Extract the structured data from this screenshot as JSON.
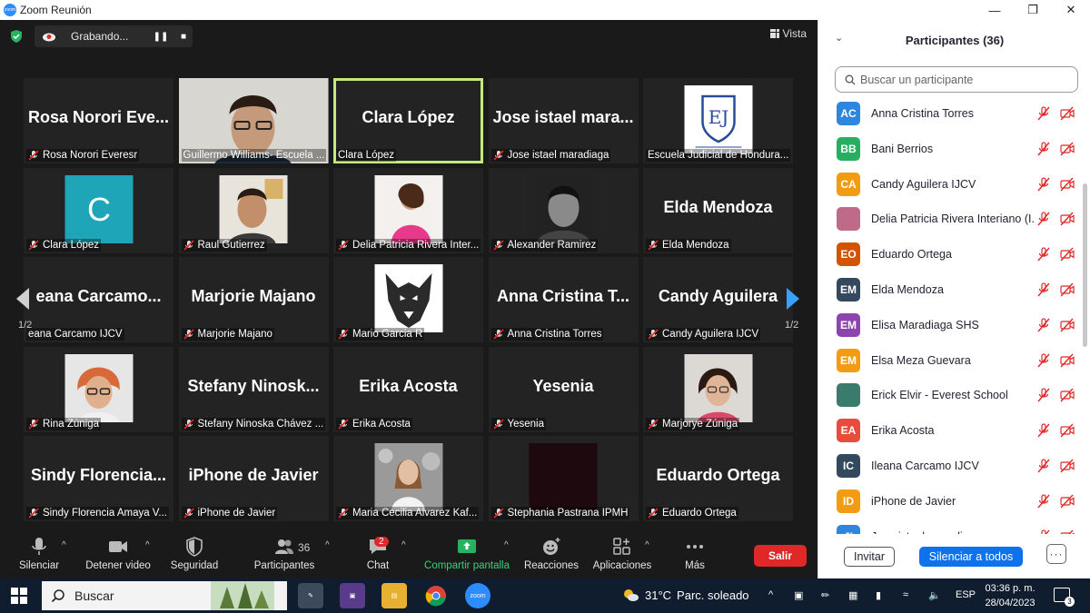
{
  "window": {
    "title": "Zoom Reunión",
    "controls": [
      "minimize",
      "maximize",
      "close"
    ]
  },
  "topbar": {
    "recording_label": "Grabando...",
    "view_label": "Vista"
  },
  "pagination": {
    "left": "1/2",
    "right": "1/2"
  },
  "tiles": [
    {
      "name": "Rosa Norori Eve...",
      "label": "Rosa Norori Everesr",
      "muted": true,
      "photo": "none"
    },
    {
      "name": "",
      "label": "Guillermo Williams- Escuela ...",
      "muted": false,
      "photo": "man-glasses"
    },
    {
      "name": "Clara López",
      "label": "Clara López",
      "muted": false,
      "photo": "none",
      "active": true
    },
    {
      "name": "Jose istael mara...",
      "label": "Jose istael maradiaga",
      "muted": true,
      "photo": "none"
    },
    {
      "name": "",
      "label": "Escuela Judicial de Hondura...",
      "muted": false,
      "photo": "logo"
    },
    {
      "name": "",
      "label": "Clara López",
      "muted": true,
      "photo": "letter-c"
    },
    {
      "name": "",
      "label": "Raul Gutierrez",
      "muted": true,
      "photo": "man-selfie"
    },
    {
      "name": "",
      "label": "Delia Patricia Rivera Inter...",
      "muted": true,
      "photo": "woman-pink"
    },
    {
      "name": "",
      "label": "Alexander Ramirez",
      "muted": true,
      "photo": "man-bw"
    },
    {
      "name": "Elda Mendoza",
      "label": "Elda Mendoza",
      "muted": true,
      "photo": "none"
    },
    {
      "name": "eana  Carcamo...",
      "label": "eana Carcamo IJCV",
      "muted": false,
      "photo": "none"
    },
    {
      "name": "Marjorie Majano",
      "label": "Marjorie Majano",
      "muted": true,
      "photo": "none"
    },
    {
      "name": "",
      "label": "Mario Garcia R",
      "muted": true,
      "photo": "wolf"
    },
    {
      "name": "Anna Cristina T...",
      "label": "Anna Cristina Torres",
      "muted": true,
      "photo": "none"
    },
    {
      "name": "Candy  Aguilera",
      "label": "Candy Aguilera IJCV",
      "muted": true,
      "photo": "none"
    },
    {
      "name": "",
      "label": "Rina Zúniga",
      "muted": true,
      "photo": "woman-glasses"
    },
    {
      "name": "Stefany  Ninosk...",
      "label": "Stefany Ninoska Chávez ...",
      "muted": true,
      "photo": "none"
    },
    {
      "name": "Erika Acosta",
      "label": "Erika Acosta",
      "muted": true,
      "photo": "none"
    },
    {
      "name": "Yesenia",
      "label": "Yesenia",
      "muted": true,
      "photo": "none"
    },
    {
      "name": "",
      "label": "Marjorye Zúniga",
      "muted": true,
      "photo": "woman-selfie"
    },
    {
      "name": "Sindy  Florencia...",
      "label": "Sindy Florencia Amaya V...",
      "muted": true,
      "photo": "none"
    },
    {
      "name": "iPhone de Javier",
      "label": "iPhone de Javier",
      "muted": true,
      "photo": "none"
    },
    {
      "name": "",
      "label": "Maria Cecilia Alvarez Kaf...",
      "muted": true,
      "photo": "woman-outdoor"
    },
    {
      "name": "",
      "label": "Stephania Pastrana IPMH",
      "muted": true,
      "photo": "dark"
    },
    {
      "name": "Eduardo Ortega",
      "label": "Eduardo Ortega",
      "muted": true,
      "photo": "none"
    }
  ],
  "toolbar": {
    "mute": "Silenciar",
    "video": "Detener video",
    "security": "Seguridad",
    "participants": "Participantes",
    "participants_count": "36",
    "chat": "Chat",
    "chat_badge": "2",
    "share": "Compartir pantalla",
    "reactions": "Reacciones",
    "apps": "Aplicaciones",
    "more": "Más",
    "leave": "Salir"
  },
  "panel": {
    "title": "Participantes (36)",
    "search_placeholder": "Buscar un participante",
    "participants": [
      {
        "initials": "AC",
        "name": "Anna Cristina Torres",
        "color": "#2e86de"
      },
      {
        "initials": "BB",
        "name": "Bani Berrios",
        "color": "#27ae60"
      },
      {
        "initials": "CA",
        "name": "Candy Aguilera IJCV",
        "color": "#f39c12"
      },
      {
        "initials": "",
        "name": "Delia Patricia Rivera Interiano (I...",
        "color": "#c06a8a"
      },
      {
        "initials": "EO",
        "name": "Eduardo Ortega",
        "color": "#d35400"
      },
      {
        "initials": "EM",
        "name": "Elda Mendoza",
        "color": "#34495e"
      },
      {
        "initials": "EM",
        "name": "Elisa Maradiaga SHS",
        "color": "#8e44ad"
      },
      {
        "initials": "EM",
        "name": "Elsa Meza Guevara",
        "color": "#f39c12"
      },
      {
        "initials": "",
        "name": "Erick Elvir - Everest School",
        "color": "#3a7b6e"
      },
      {
        "initials": "EA",
        "name": "Erika Acosta",
        "color": "#e74c3c"
      },
      {
        "initials": "IC",
        "name": "Ileana Carcamo IJCV",
        "color": "#34495e"
      },
      {
        "initials": "ID",
        "name": "iPhone de Javier",
        "color": "#f39c12"
      },
      {
        "initials": "JI",
        "name": "Jose istael maradiaga",
        "color": "#2e86de"
      }
    ],
    "invite": "Invitar",
    "mute_all": "Silenciar a todos",
    "more": "···"
  },
  "taskbar": {
    "search": "Buscar",
    "weather_temp": "31°C",
    "weather_desc": "Parc. soleado",
    "lang": "ESP",
    "time": "03:36 p. m.",
    "date": "28/04/2023",
    "notifications": "3"
  }
}
